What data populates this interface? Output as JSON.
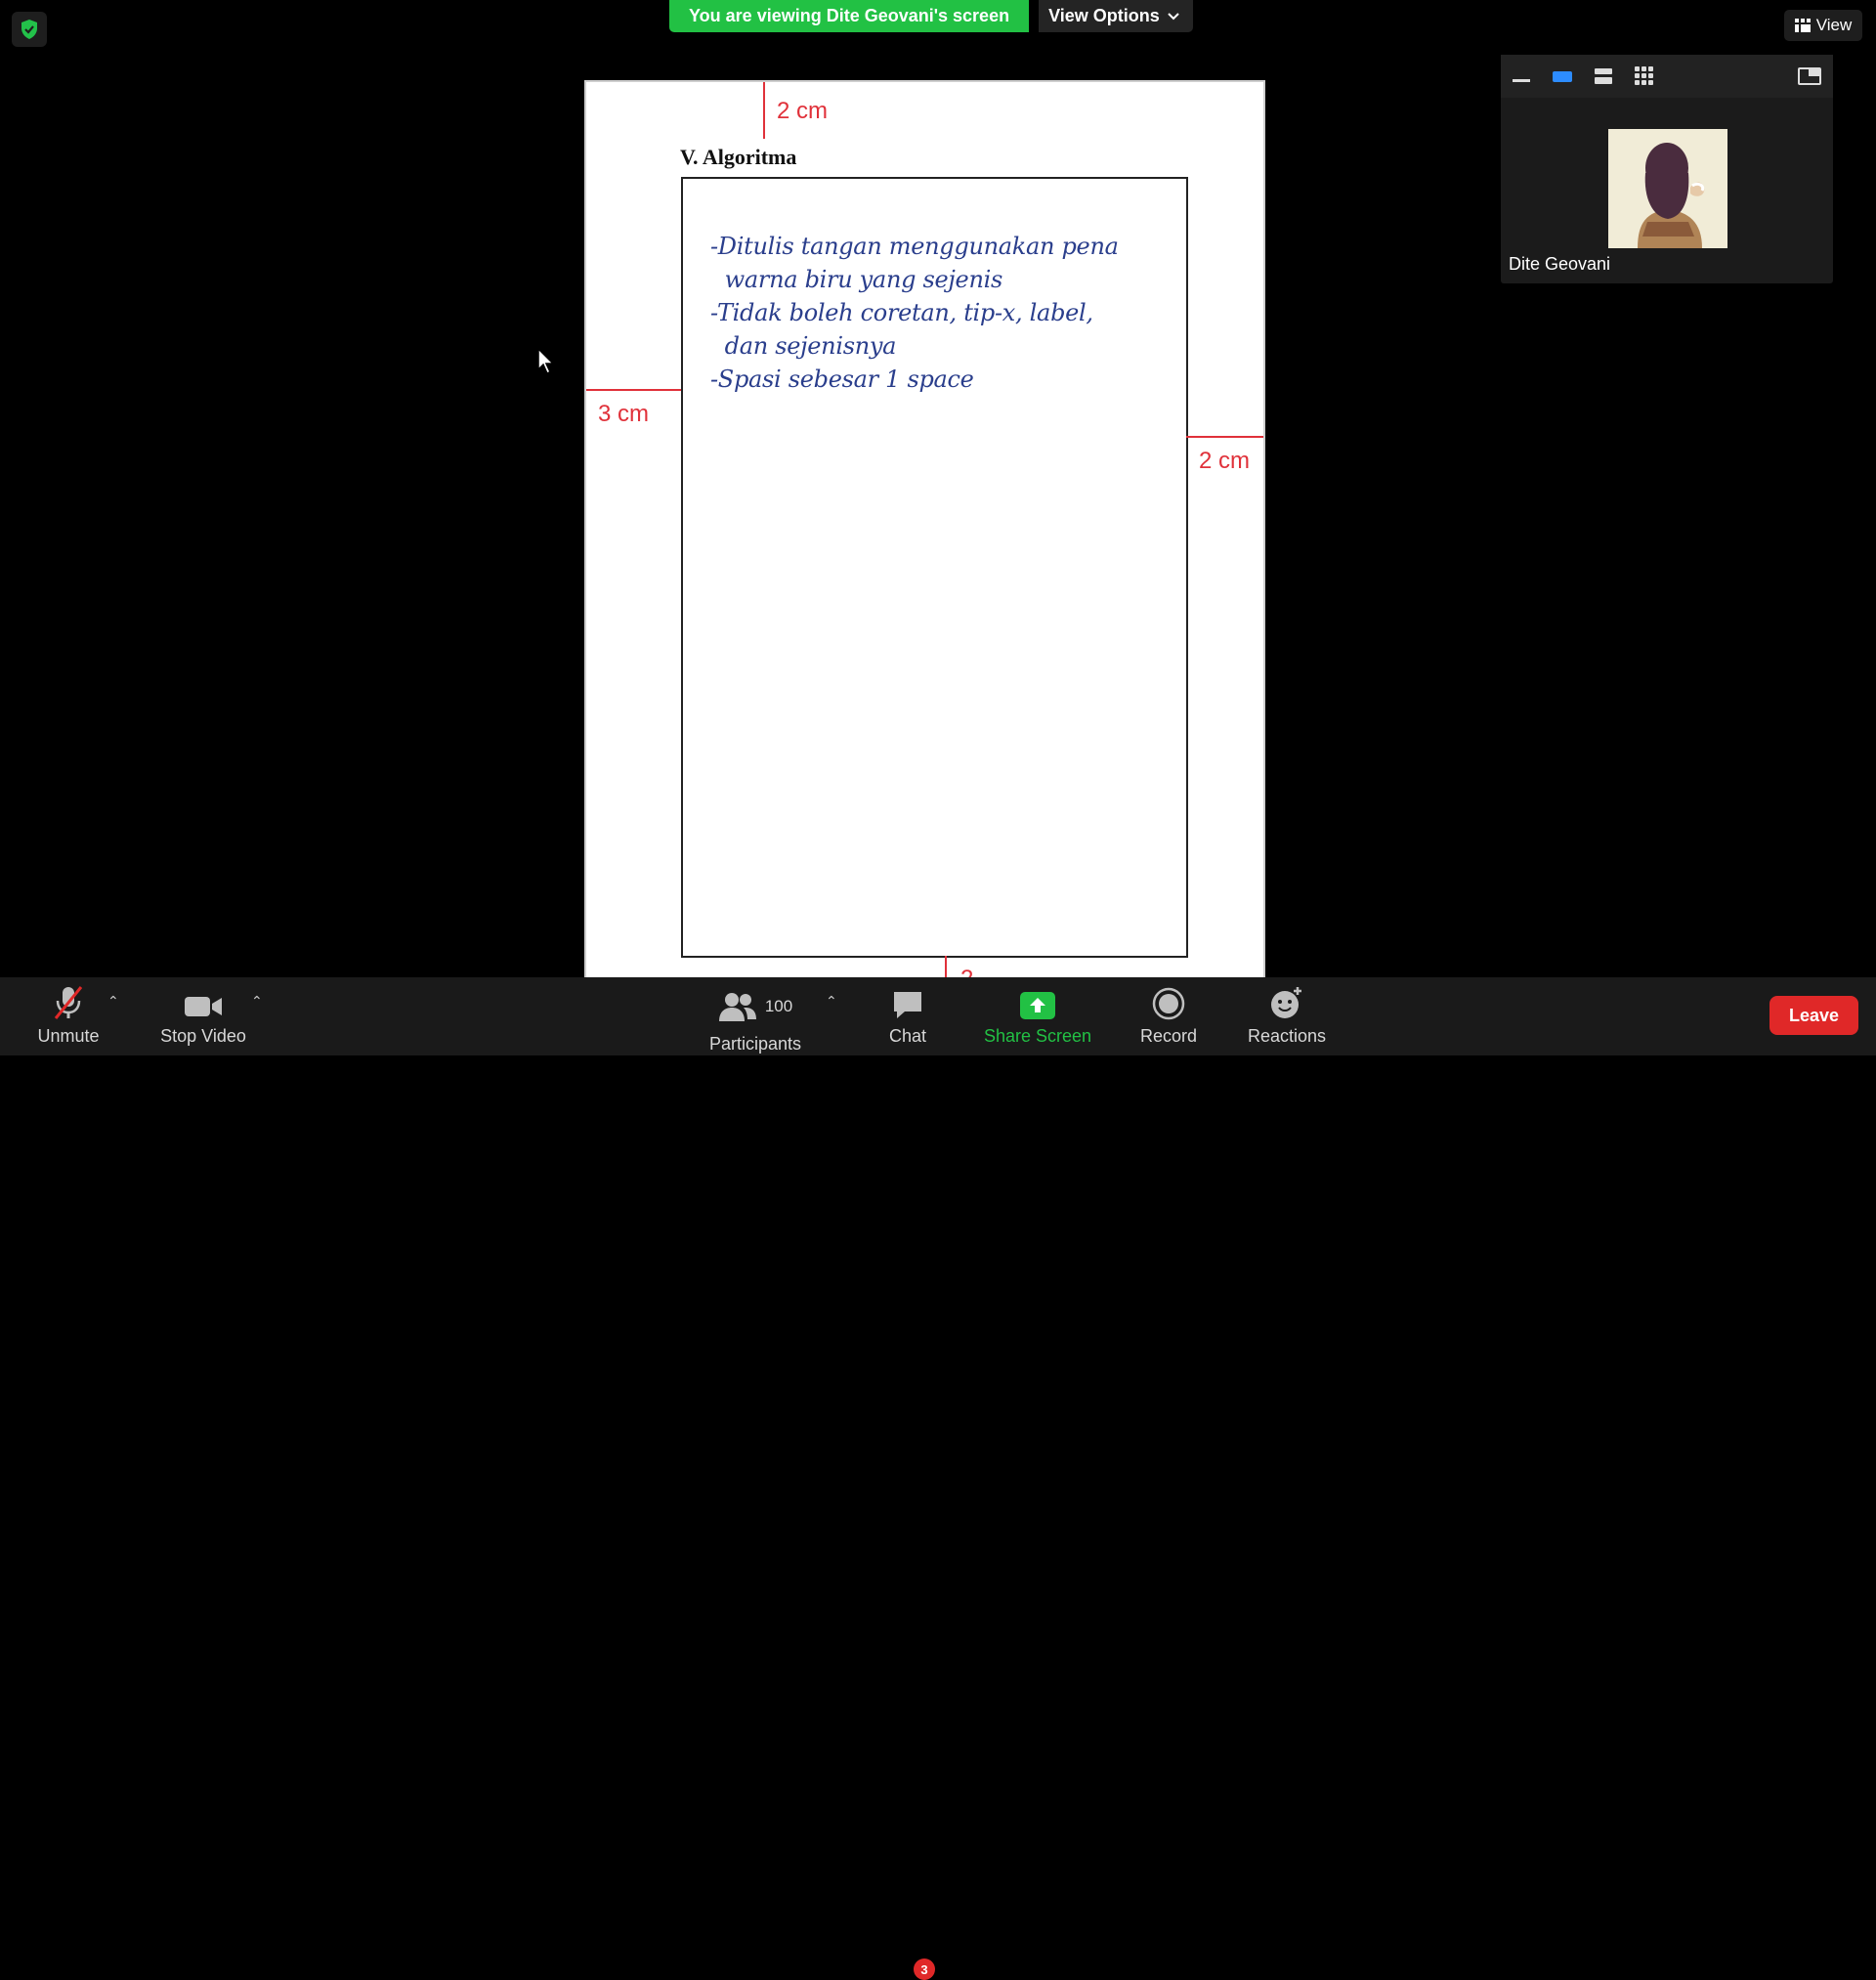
{
  "banner": {
    "viewing_text": "You are viewing Dite Geovani's screen",
    "view_options_label": "View Options"
  },
  "top_right": {
    "view_label": "View"
  },
  "panel": {
    "participant_name": "Dite Geovani",
    "toolbar_icons": [
      "minimize-icon",
      "speaker-view-icon",
      "thumbnail-strip-icon",
      "gallery-grid-icon",
      "pin-panel-icon"
    ]
  },
  "document": {
    "section_title": "V.  Algoritma",
    "margin_top": "2 cm",
    "margin_left": "3 cm",
    "margin_right": "2 cm",
    "margin_bottom_partial": "2",
    "handwritten_lines": [
      "-Ditulis tangan menggunakan pena",
      "  warna biru yang sejenis",
      "-Tidak boleh coretan, tip-x, label,",
      "  dan sejenisnya",
      "-Spasi sebesar 1 space"
    ],
    "colors": {
      "margin_marker": "#e0313a",
      "ink": "#2a3e8c"
    }
  },
  "toolbar": {
    "unmute_label": "Unmute",
    "stop_video_label": "Stop Video",
    "participants_label": "Participants",
    "participants_count": "100",
    "chat_label": "Chat",
    "chat_badge": "3",
    "share_screen_label": "Share Screen",
    "record_label": "Record",
    "reactions_label": "Reactions",
    "leave_label": "Leave",
    "colors": {
      "share_green": "#22c144",
      "leave_red": "#e02828"
    }
  }
}
